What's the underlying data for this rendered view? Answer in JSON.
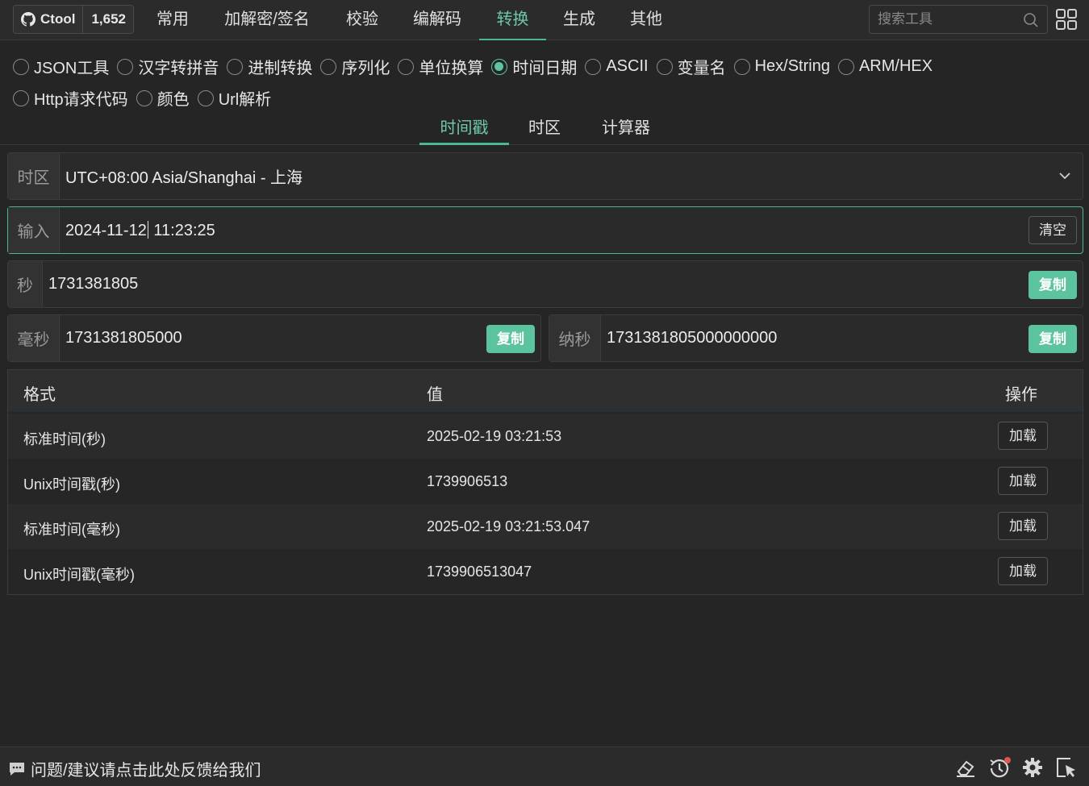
{
  "github": {
    "label": "Ctool",
    "count": "1,652"
  },
  "nav": [
    {
      "label": "常用",
      "active": false
    },
    {
      "label": "加解密/签名",
      "active": false
    },
    {
      "label": "校验",
      "active": false
    },
    {
      "label": "编解码",
      "active": false
    },
    {
      "label": "转换",
      "active": true
    },
    {
      "label": "生成",
      "active": false
    },
    {
      "label": "其他",
      "active": false
    }
  ],
  "search": {
    "placeholder": "搜索工具"
  },
  "tools": [
    {
      "label": "JSON工具",
      "checked": false
    },
    {
      "label": "汉字转拼音",
      "checked": false
    },
    {
      "label": "进制转换",
      "checked": false
    },
    {
      "label": "序列化",
      "checked": false
    },
    {
      "label": "单位换算",
      "checked": false
    },
    {
      "label": "时间日期",
      "checked": true
    },
    {
      "label": "ASCII",
      "checked": false
    },
    {
      "label": "变量名",
      "checked": false
    },
    {
      "label": "Hex/String",
      "checked": false
    },
    {
      "label": "ARM/HEX",
      "checked": false
    },
    {
      "label": "Http请求代码",
      "checked": false
    },
    {
      "label": "颜色",
      "checked": false
    },
    {
      "label": "Url解析",
      "checked": false
    }
  ],
  "subtabs": [
    {
      "label": "时间戳",
      "active": true
    },
    {
      "label": "时区",
      "active": false
    },
    {
      "label": "计算器",
      "active": false
    }
  ],
  "timezone": {
    "label": "时区",
    "value": "UTC+08:00 Asia/Shanghai - 上海"
  },
  "input": {
    "label": "输入",
    "value_before": "2024-11-12",
    "value_after": " 11:23:25",
    "clear": "清空"
  },
  "seconds": {
    "label": "秒",
    "value": "1731381805",
    "copy": "复制"
  },
  "millis": {
    "label": "毫秒",
    "value": "1731381805000",
    "copy": "复制"
  },
  "nanos": {
    "label": "纳秒",
    "value": "1731381805000000000",
    "copy": "复制"
  },
  "table": {
    "headers": {
      "format": "格式",
      "value": "值",
      "action": "操作"
    },
    "rows": [
      {
        "format": "标准时间(秒)",
        "value": "2025-02-19 03:21:53",
        "action": "加载"
      },
      {
        "format": "Unix时间戳(秒)",
        "value": "1739906513",
        "action": "加载"
      },
      {
        "format": "标准时间(毫秒)",
        "value": "2025-02-19 03:21:53.047",
        "action": "加载"
      },
      {
        "format": "Unix时间戳(毫秒)",
        "value": "1739906513047",
        "action": "加载"
      }
    ]
  },
  "footer": {
    "feedback": "问题/建议请点击此处反馈给我们"
  },
  "colors": {
    "accent": "#5cc39f",
    "background": "#252525",
    "notify_dot": "#e05555"
  }
}
